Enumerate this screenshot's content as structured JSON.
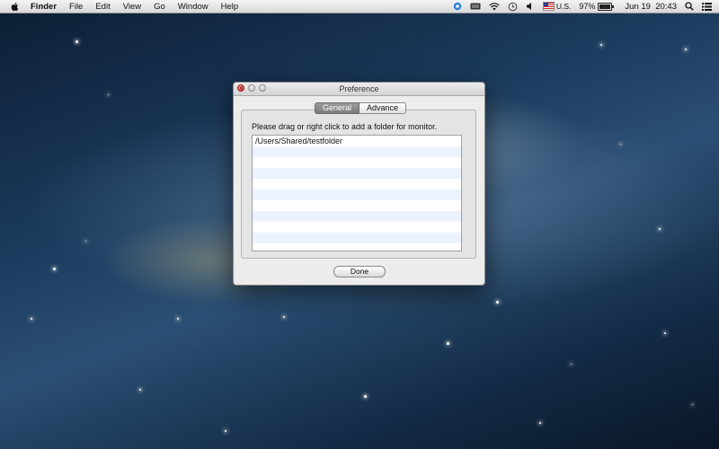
{
  "menubar": {
    "app_name": "Finder",
    "items": [
      "File",
      "Edit",
      "View",
      "Go",
      "Window",
      "Help"
    ],
    "status": {
      "input_source": "U.S.",
      "battery_percent": "97%",
      "battery_level": 0.97,
      "date_time": "Jun 19  20:43"
    },
    "icons": [
      "apple-icon",
      "screen-share-icon",
      "display-icon",
      "wifi-icon",
      "time-machine-icon",
      "volume-icon",
      "flag-icon",
      "battery-icon",
      "search-icon",
      "list-icon"
    ]
  },
  "window": {
    "title": "Preference",
    "tabs": {
      "general": "General",
      "advance": "Advance"
    },
    "instruction": "Please drag or right click to add a folder for monitor.",
    "folders": [
      "/Users/Shared/testfolder",
      "",
      "",
      "",
      "",
      "",
      "",
      "",
      "",
      ""
    ],
    "done_label": "Done"
  }
}
